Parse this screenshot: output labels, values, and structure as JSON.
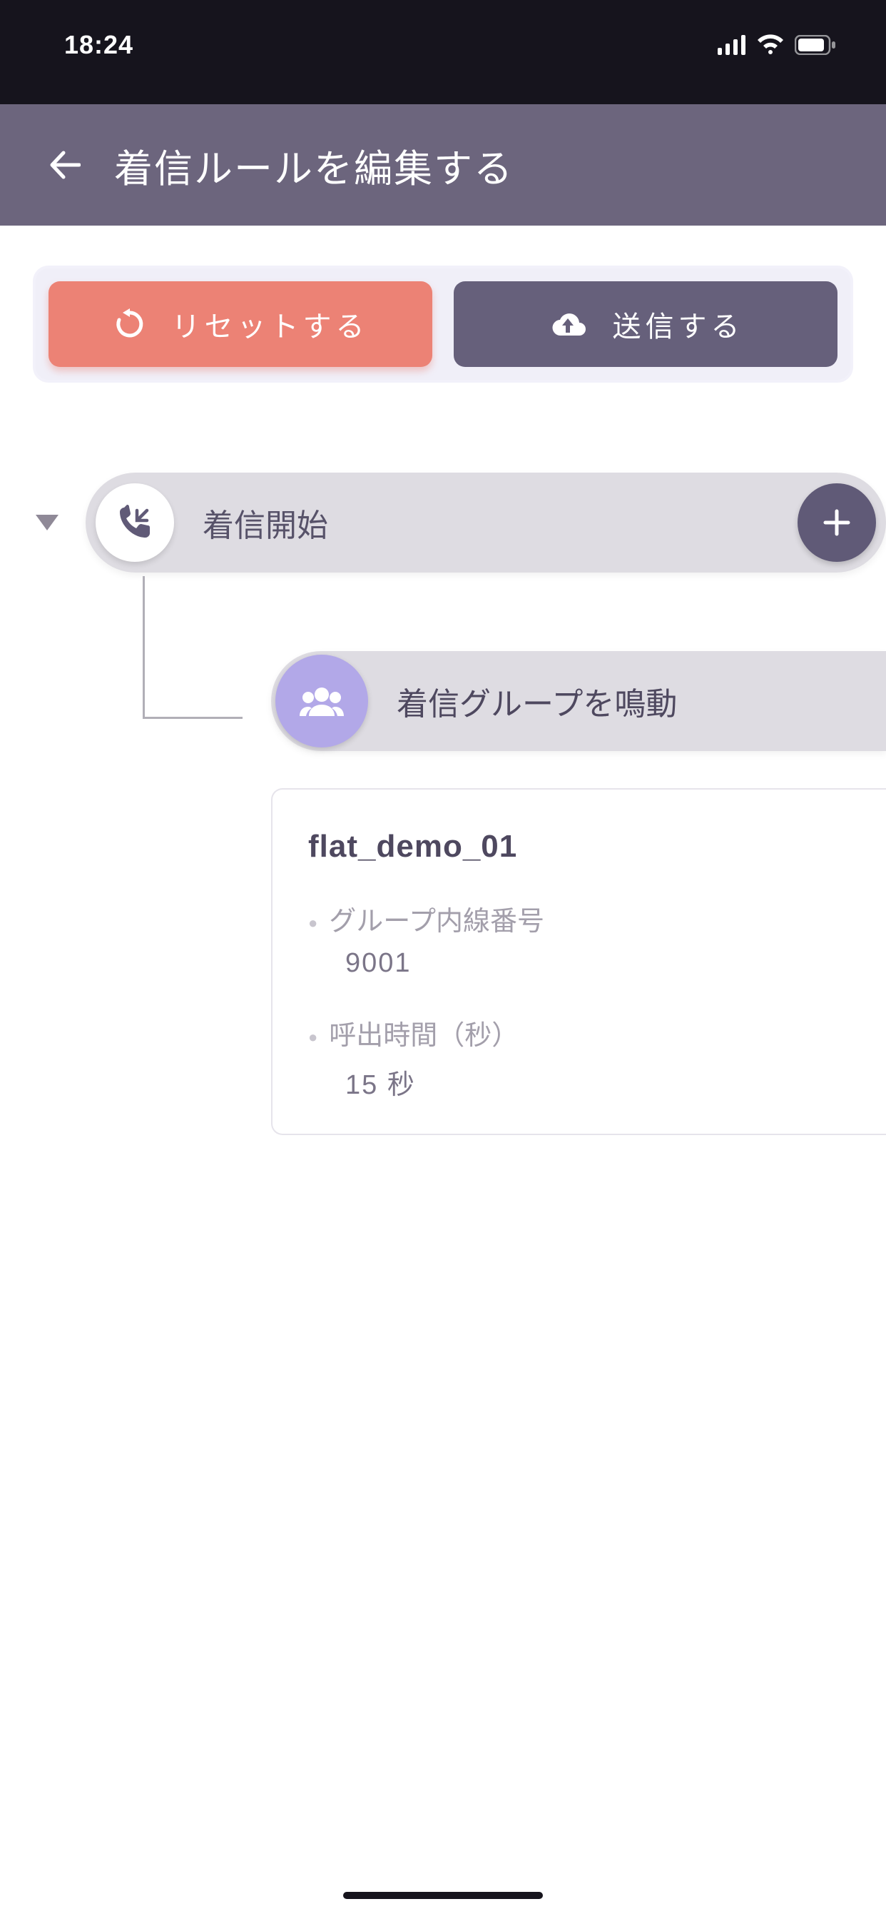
{
  "status": {
    "time": "18:24"
  },
  "header": {
    "title": "着信ルールを編集する"
  },
  "actions": {
    "reset_label": "リセットする",
    "send_label": "送信する"
  },
  "flow": {
    "start_label": "着信開始",
    "child_label": "着信グループを鳴動"
  },
  "detail": {
    "group_name": "flat_demo_01",
    "ext_label": "グループ内線番号",
    "ext_value": "9001",
    "ring_label": "呼出時間（秒）",
    "ring_value": "15 秒"
  }
}
